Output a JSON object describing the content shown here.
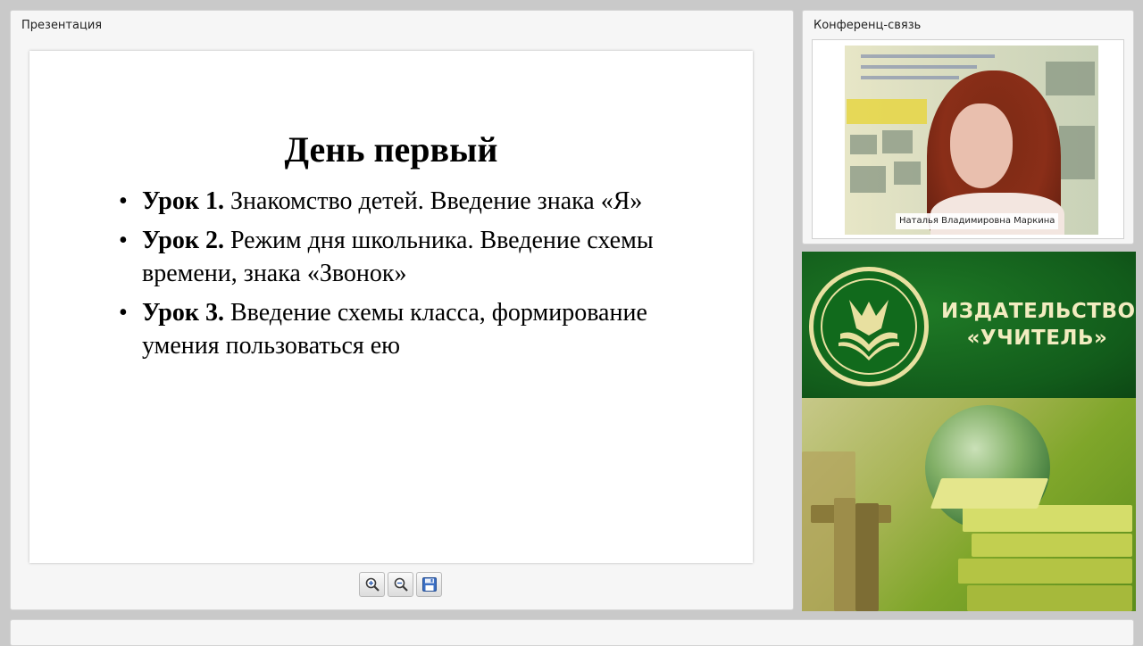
{
  "presentation_panel": {
    "title": "Презентация"
  },
  "slide": {
    "title": "День первый",
    "items": [
      {
        "bold": "Урок 1.",
        "text": " Знакомство детей. Введение знака «Я»"
      },
      {
        "bold": "Урок 2.",
        "text": " Режим дня школьника. Введение схемы времени, знака «Звонок»"
      },
      {
        "bold": "Урок 3.",
        "text": " Введение схемы класса, формирование умения пользоваться ею"
      }
    ]
  },
  "toolbar": {
    "zoom_in_icon": "magnifier-plus",
    "zoom_out_icon": "magnifier-minus",
    "save_icon": "floppy-disk"
  },
  "conference_panel": {
    "title": "Конференц-связь",
    "participant_name": "Наталья Владимировна Маркина"
  },
  "banner": {
    "line1": "ИЗДАТЕЛЬСТВО",
    "line2": "«УЧИТЕЛЬ»",
    "brand_green": "#125c1b",
    "text_color": "#f2ecc0"
  }
}
